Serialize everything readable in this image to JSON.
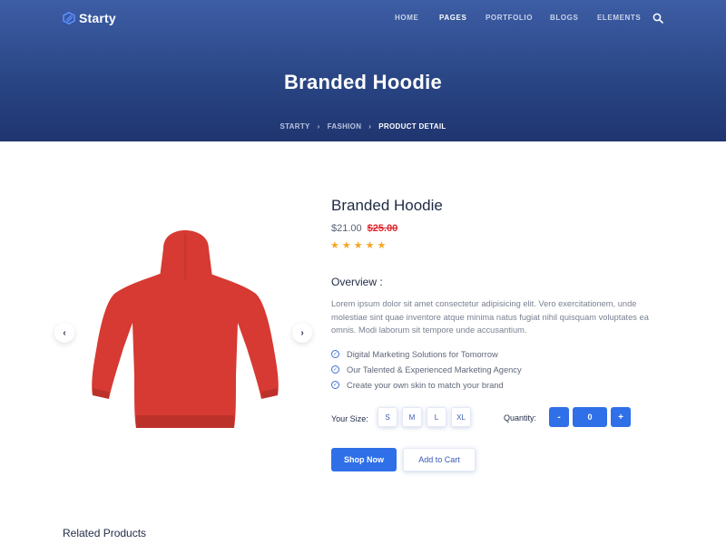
{
  "brand": {
    "name": "Starty"
  },
  "nav": {
    "items": [
      {
        "label": "HOME"
      },
      {
        "label": "PAGES"
      },
      {
        "label": "PORTFOLIO"
      },
      {
        "label": "BLOGS"
      },
      {
        "label": "ELEMENTS"
      }
    ],
    "active": "PAGES",
    "search_icon": "search-icon"
  },
  "hero": {
    "title": "Branded Hoodie",
    "breadcrumb": [
      "STARTY",
      "FASHION",
      "PRODUCT DETAIL"
    ]
  },
  "product": {
    "title": "Branded Hoodie",
    "price": "$21.00",
    "old_price": "$25.00",
    "rating": 5,
    "rating_max": 5,
    "overview_heading": "Overview :",
    "description": "Lorem ipsum dolor sit amet consectetur adipisicing elit. Vero exercitationem, unde molestiae sint quae inventore atque minima natus fugiat nihil quisquam voluptates ea omnis. Modi laborum sit tempore unde accusantium.",
    "features": [
      "Digital Marketing Solutions for Tomorrow",
      "Our Talented & Experienced Marketing Agency",
      "Create your own skin to match your brand"
    ],
    "size_label": "Your Size:",
    "sizes": [
      "S",
      "M",
      "L",
      "XL"
    ],
    "quantity_label": "Quantity:",
    "quantity": "0",
    "decrement": "-",
    "increment": "+",
    "shop_now": "Shop Now",
    "add_to_cart": "Add to Cart",
    "image_color": "#d63a32"
  },
  "related_heading": "Related Products",
  "colors": {
    "accent": "#2f6fe8",
    "hero_top": "#3d5da5",
    "hero_bottom": "#1f3570",
    "old_price": "#e0262c",
    "star": "#f5a623"
  }
}
